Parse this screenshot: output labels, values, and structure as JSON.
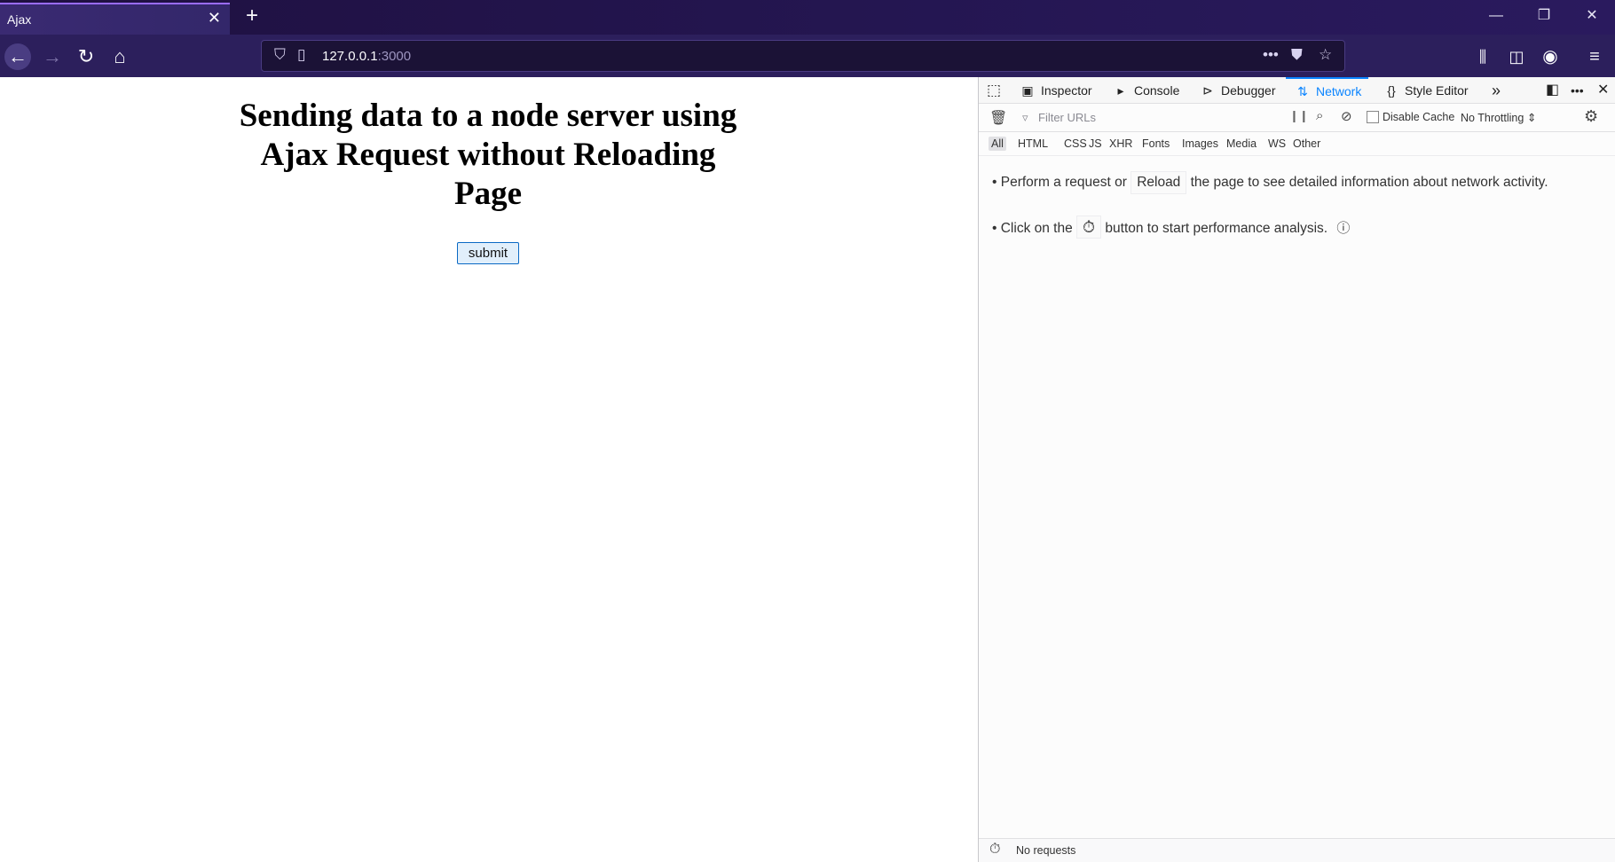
{
  "browser": {
    "tab_title": "Ajax",
    "url_host": "127.0.0.1",
    "url_port": ":3000"
  },
  "page": {
    "heading": "Sending data to a node server using Ajax Request without Reloading Page",
    "button_label": "submit"
  },
  "devtools": {
    "tabs": [
      "Inspector",
      "Console",
      "Debugger",
      "Network",
      "Style Editor"
    ],
    "active_tab": "Network",
    "filter_placeholder": "Filter URLs",
    "disable_cache_label": "Disable Cache",
    "throttling": "No Throttling",
    "types": [
      "All",
      "HTML",
      "CSS",
      "JS",
      "XHR",
      "Fonts",
      "Images",
      "Media",
      "WS",
      "Other"
    ],
    "notice": {
      "line1_prefix": "• Perform a request or",
      "reload_label": "Reload",
      "line1_suffix": "the page to see detailed information about network activity.",
      "line2_prefix": "• Click on the",
      "line2_suffix": "button to start performance analysis."
    },
    "status": "No requests"
  }
}
